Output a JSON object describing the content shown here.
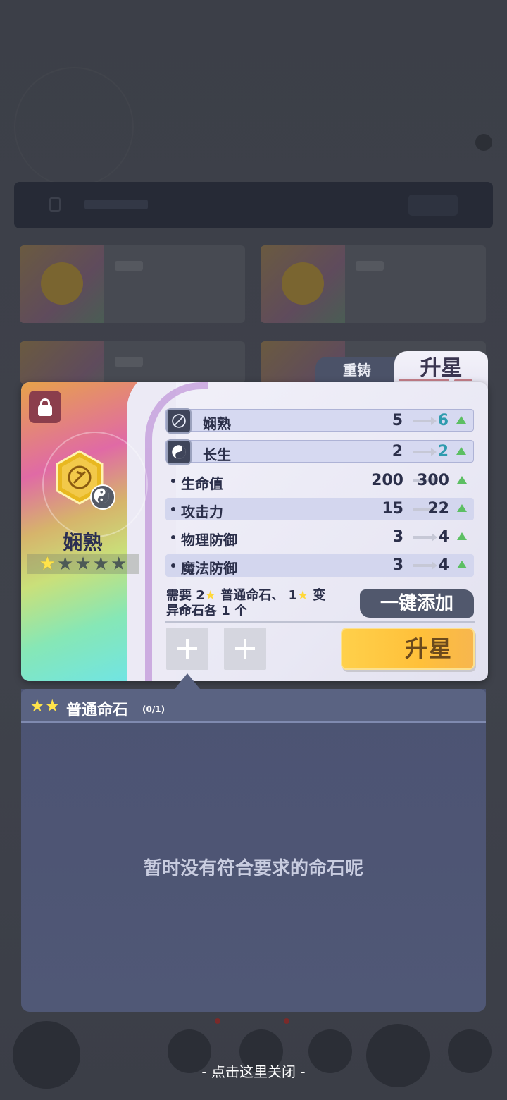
{
  "tabs": {
    "reforge": "重铸",
    "upgrade": "升星"
  },
  "stone": {
    "name": "娴熟",
    "stars_filled": 1,
    "stars_total": 5
  },
  "stats": [
    {
      "label": "娴熟",
      "from": "5",
      "to": "6",
      "icon": "skill-icon"
    },
    {
      "label": "长生",
      "from": "2",
      "to": "2",
      "icon": "yin-yang-icon"
    },
    {
      "label": "生命值",
      "from": "200",
      "to": "300"
    },
    {
      "label": "攻击力",
      "from": "15",
      "to": "22"
    },
    {
      "label": "物理防御",
      "from": "3",
      "to": "4"
    },
    {
      "label": "魔法防御",
      "from": "3",
      "to": "4"
    }
  ],
  "requirement": {
    "part1": "需要 2",
    "part2": " 普通命石、 1",
    "part3": " 变",
    "part4": "异命石各 1 个"
  },
  "buttons": {
    "auto_add": "一键添加",
    "upgrade": "升星"
  },
  "list": {
    "title": "普通命石",
    "count": "(0/1)",
    "empty": "暂时没有符合要求的命石呢"
  },
  "close_hint": "- 点击这里关闭 -",
  "colors": {
    "accent_gold": "#ffc03a",
    "tab_active": "#f3f2fa",
    "up_arrow": "#5cbf63",
    "teal_value": "#2e9bae"
  }
}
